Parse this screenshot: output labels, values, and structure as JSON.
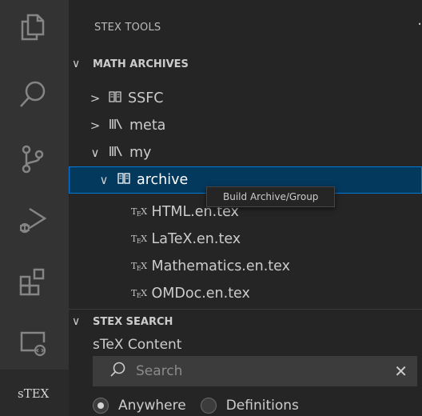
{
  "activity_bar": {
    "icons": [
      "explorer-icon",
      "search-icon",
      "source-control-icon",
      "run-debug-icon",
      "extensions-icon",
      "remote-explorer-icon"
    ],
    "stex_label": "sTEX"
  },
  "sidebar": {
    "view_title": "STEX TOOLS",
    "more_label": "·",
    "math_archives": {
      "header": "MATH ARCHIVES",
      "items": [
        {
          "label": "SSFC",
          "twist": ">",
          "icon": "book-icon"
        },
        {
          "label": "meta",
          "twist": ">",
          "icon": "library-icon"
        },
        {
          "label": "my",
          "twist": "∨",
          "icon": "library-icon"
        },
        {
          "label": "archive",
          "twist": "∨",
          "icon": "book-icon"
        }
      ],
      "files": [
        {
          "label": "HTML.en.tex"
        },
        {
          "label": "LaTeX.en.tex"
        },
        {
          "label": "Mathematics.en.tex"
        },
        {
          "label": "OMDoc.en.tex"
        }
      ],
      "file_icon_text": "TEX"
    },
    "tooltip": "Build Archive/Group",
    "stex_search": {
      "header": "STEX SEARCH",
      "content_label": "sTeX Content",
      "search_placeholder": "Search",
      "search_value": "",
      "clear_label": "✕",
      "options": [
        "Anywhere",
        "Definitions"
      ],
      "selected_option": "Anywhere"
    }
  },
  "colors": {
    "activity_bar": "#333333",
    "sidebar": "#252526",
    "selection": "#04395e",
    "focus_border": "#0078d4"
  }
}
